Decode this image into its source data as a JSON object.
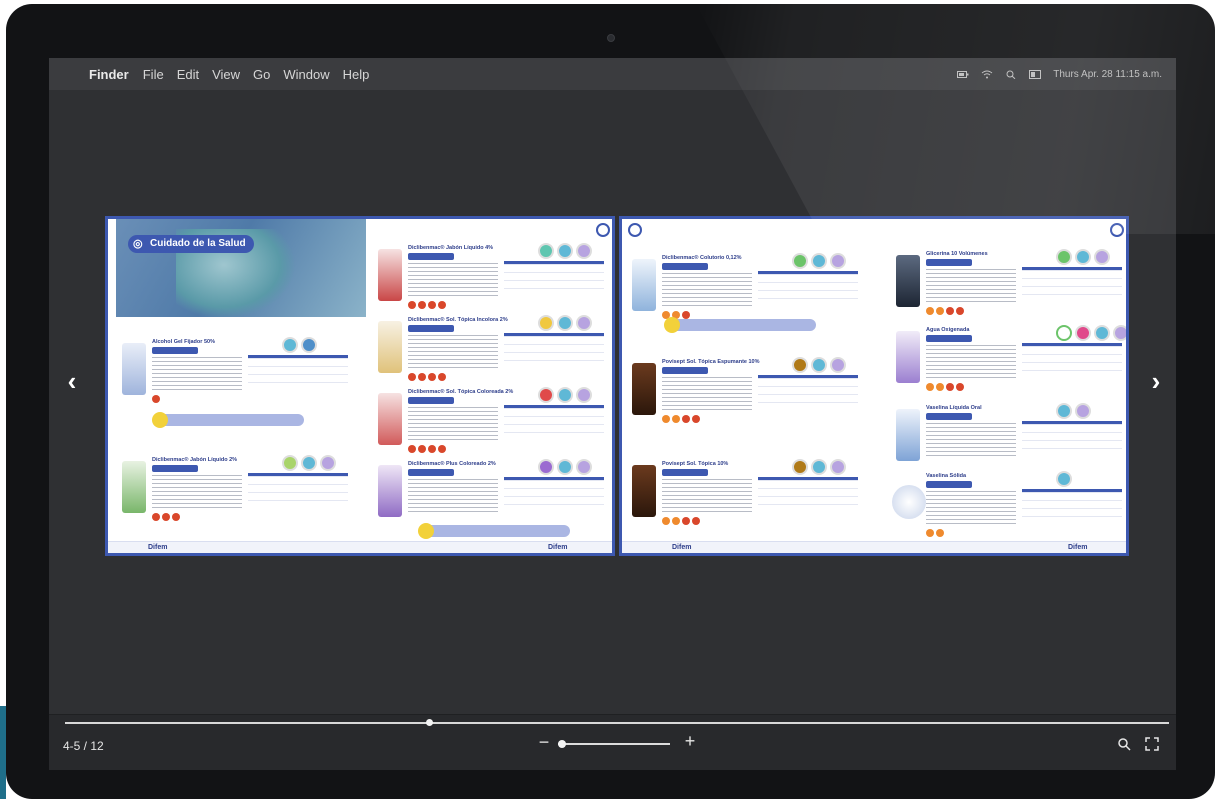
{
  "menubar": {
    "app_name": "Finder",
    "menus": [
      "File",
      "Edit",
      "View",
      "Go",
      "Window",
      "Help"
    ],
    "clock": "Thurs Apr. 28  11:15 a.m."
  },
  "document": {
    "section_title": "Cuidado de la Salud",
    "products": [
      "Alcohol Gel Fijador 50%",
      "Diclibenmac® Jabón Líquido 2%",
      "Diclibenmac® Jabón Líquido 4%",
      "Diclibenmac® Sol. Tópica Incolora 2%",
      "Diclibenmac® Sol. Tópica Coloreada 2%",
      "Diclibenmac® Plus Coloreado 2%",
      "Diclibenmac® Colutorio 0,12%",
      "Povisept Sol. Tópica Espumante 10%",
      "Povisept Sol. Tópica 10%",
      "Glicerina 10 Volúmenes",
      "Agua Oxigenada",
      "Vaselina Líquida Oral",
      "Vaselina Sólida"
    ],
    "brand": "Difem"
  },
  "viewer": {
    "page_counter": "4-5 / 12",
    "progress_fraction": 0.33,
    "zoom_fraction": 0.0,
    "prev_icon": "‹",
    "next_icon": "›",
    "zoom_out_icon": "−",
    "zoom_in_icon": "+"
  }
}
